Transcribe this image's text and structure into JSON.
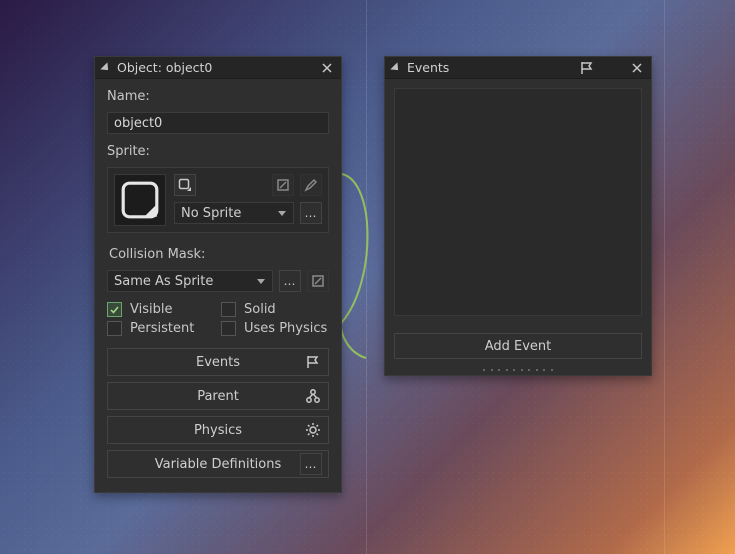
{
  "object_panel": {
    "title": "Object: object0",
    "name_label": "Name:",
    "name_value": "object0",
    "sprite_label": "Sprite:",
    "sprite_name": "No Sprite",
    "collision_label": "Collision Mask:",
    "collision_value": "Same As Sprite",
    "checks": {
      "visible": "Visible",
      "solid": "Solid",
      "persistent": "Persistent",
      "uses_physics": "Uses Physics",
      "visible_checked": true,
      "solid_checked": false,
      "persistent_checked": false,
      "uses_physics_checked": false
    },
    "buttons": {
      "events": "Events",
      "parent": "Parent",
      "physics": "Physics",
      "vardefs": "Variable Definitions"
    }
  },
  "events_panel": {
    "title": "Events",
    "add_event": "Add Event"
  },
  "icons": {
    "close": "close-icon",
    "flag": "flag-icon",
    "new_sprite": "new-sprite-icon",
    "edit_mask": "edit-mask-icon",
    "edit_sprite": "edit-sprite-icon",
    "collision_edit": "collision-edit-icon",
    "events": "flag-icon",
    "parent": "parent-icon",
    "physics": "gear-icon",
    "dots": "more-icon"
  }
}
